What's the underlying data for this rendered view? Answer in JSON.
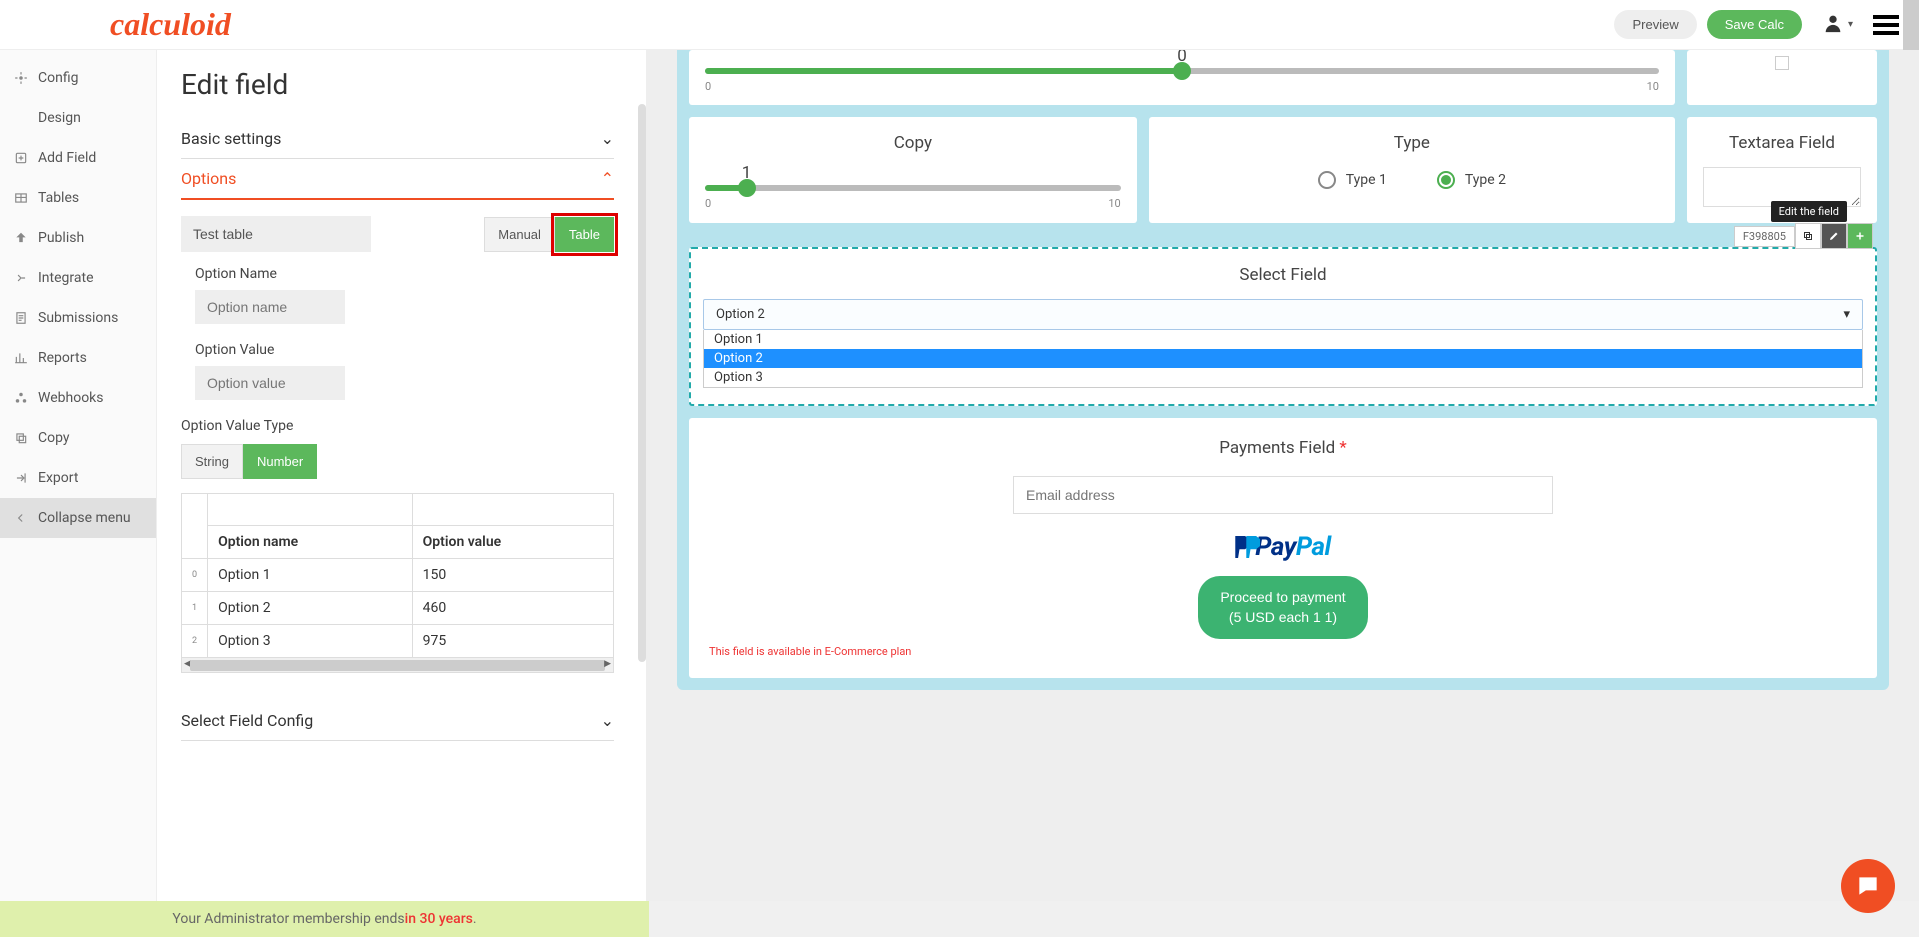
{
  "brand": "calculoid",
  "topbar": {
    "preview": "Preview",
    "save": "Save Calc"
  },
  "sidebar": {
    "items": [
      {
        "key": "config",
        "label": "Config"
      },
      {
        "key": "design",
        "label": "Design"
      },
      {
        "key": "addfield",
        "label": "Add Field"
      },
      {
        "key": "tables",
        "label": "Tables"
      },
      {
        "key": "publish",
        "label": "Publish"
      },
      {
        "key": "integrate",
        "label": "Integrate"
      },
      {
        "key": "submissions",
        "label": "Submissions"
      },
      {
        "key": "reports",
        "label": "Reports"
      },
      {
        "key": "webhooks",
        "label": "Webhooks"
      },
      {
        "key": "copy",
        "label": "Copy"
      },
      {
        "key": "export",
        "label": "Export"
      },
      {
        "key": "collapse",
        "label": "Collapse menu"
      }
    ]
  },
  "edit": {
    "title": "Edit field",
    "sections": {
      "basic": "Basic settings",
      "options": "Options",
      "selectConfig": "Select Field Config"
    },
    "testTable": "Test table",
    "mode": {
      "manual": "Manual",
      "table": "Table"
    },
    "labels": {
      "optionName": "Option Name",
      "optionValue": "Option Value",
      "optionValueType": "Option Value Type"
    },
    "placeholders": {
      "optionName": "Option name",
      "optionValue": "Option value"
    },
    "valueType": {
      "string": "String",
      "number": "Number"
    },
    "tableHeaders": {
      "name": "Option name",
      "value": "Option value"
    },
    "tableRows": [
      {
        "idx": "0",
        "name": "Option 1",
        "value": "150"
      },
      {
        "idx": "1",
        "name": "Option 2",
        "value": "460"
      },
      {
        "idx": "2",
        "name": "Option 3",
        "value": "975"
      }
    ]
  },
  "preview": {
    "slider0": {
      "value": "0",
      "min": "0",
      "max": "10",
      "fillPct": 50
    },
    "copy": {
      "title": "Copy",
      "value": "1",
      "min": "0",
      "max": "10",
      "fillPct": 10
    },
    "type": {
      "title": "Type",
      "opt1": "Type 1",
      "opt2": "Type 2"
    },
    "textarea": {
      "title": "Textarea Field"
    },
    "select": {
      "title": "Select Field",
      "fieldId": "F398805",
      "tooltip": "Edit the field",
      "selected": "Option 2",
      "options": [
        "Option 1",
        "Option 2",
        "Option 3"
      ]
    },
    "payments": {
      "title": "Payments Field",
      "emailPlaceholder": "Email address",
      "paypal1": "Pay",
      "paypal2": "Pal",
      "proceedL1": "Proceed to payment",
      "proceedL2": "(5 USD each 1 1)",
      "note": "This field is available in E-Commerce plan"
    }
  },
  "membership": {
    "prefix": "Your Administrator membership ends ",
    "accent": "in 30 years",
    "suffix": "."
  }
}
